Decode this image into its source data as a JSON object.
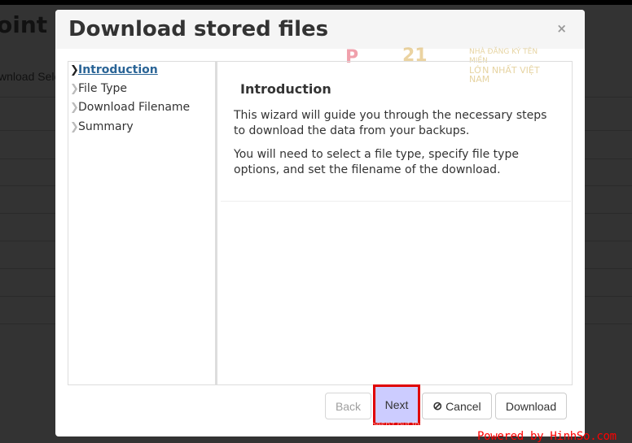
{
  "background": {
    "title": "oint",
    "subtitle": "wnload Sele"
  },
  "modal": {
    "title": "Download stored files",
    "close": "×"
  },
  "logo": {
    "line1": "NHÀ ĐĂNG KÝ TÊN MIỀN",
    "line2": "LỚN NHẤT VIỆT NAM"
  },
  "steps": [
    {
      "label": "Introduction",
      "active": true
    },
    {
      "label": "File Type"
    },
    {
      "label": "Download Filename"
    },
    {
      "label": "Summary"
    }
  ],
  "content": {
    "heading": "Introduction",
    "p1": "This wizard will guide you through the necessary steps to download the data from your backups.",
    "p2": "You will need to select a file type, specify file type options, and set the filename of the download."
  },
  "buttons": {
    "back": "Back",
    "next": "Next",
    "cancel": "Cancel",
    "download": "Download"
  },
  "watermark": "Protected with free version of Watermarkly. Full version doesn't put this mark.",
  "powered": "Powered by HinhSo.com"
}
